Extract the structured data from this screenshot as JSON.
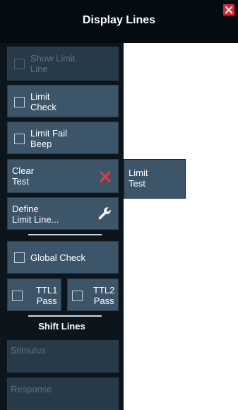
{
  "header": {
    "title": "Display Lines"
  },
  "buttons": {
    "show_limit_line": {
      "label": "Show Limit\nLine"
    },
    "limit_check": {
      "label": "Limit\nCheck"
    },
    "limit_fail_beep": {
      "label": "Limit Fail\nBeep"
    },
    "clear_test": {
      "label": "Clear\nTest"
    },
    "define_limit_line": {
      "label": "Define\nLimit Line..."
    },
    "global_check": {
      "label": "Global Check"
    },
    "ttl1_pass": {
      "label": "TTL1\nPass"
    },
    "ttl2_pass": {
      "label": "TTL2\nPass"
    }
  },
  "shift_lines": {
    "title": "Shift Lines",
    "stimulus": "Stimulus",
    "response": "Response"
  },
  "softkey": {
    "label": "Limit\nTest"
  },
  "colors": {
    "header_bg": "#040c12",
    "panel_bg": "#0c151c",
    "button_bg": "#3d5568",
    "button_disabled_bg": "#283a47",
    "close_red": "#e8202a"
  },
  "icons": {
    "close": "close-icon",
    "clear": "x-icon",
    "define": "wrench-icon"
  }
}
